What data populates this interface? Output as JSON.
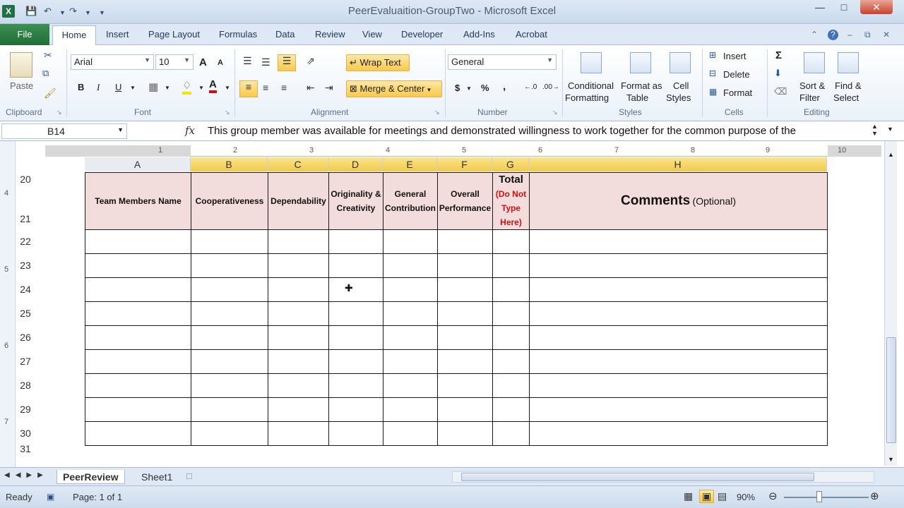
{
  "window": {
    "title": "PeerEvaluaition-GroupTwo - Microsoft Excel",
    "app_icon": "X"
  },
  "ribbon": {
    "tabs": [
      "File",
      "Home",
      "Insert",
      "Page Layout",
      "Formulas",
      "Data",
      "Review",
      "View",
      "Developer",
      "Add-Ins",
      "Acrobat"
    ],
    "clipboard": {
      "paste": "Paste",
      "label": "Clipboard"
    },
    "font": {
      "name": "Arial",
      "size": "10",
      "bold": "B",
      "italic": "I",
      "underline": "U",
      "label": "Font",
      "grow": "A",
      "shrink": "A"
    },
    "alignment": {
      "wrap_text": "Wrap Text",
      "merge_center": "Merge & Center",
      "label": "Alignment"
    },
    "number": {
      "format": "General",
      "currency": "$",
      "percent": "%",
      "comma": ",",
      "label": "Number"
    },
    "styles": {
      "conditional_1": "Conditional",
      "conditional_2": "Formatting",
      "format_table_1": "Format as",
      "format_table_2": "Table",
      "cell_styles_1": "Cell",
      "cell_styles_2": "Styles",
      "label": "Styles"
    },
    "cells": {
      "insert": "Insert",
      "delete": "Delete",
      "format": "Format",
      "label": "Cells"
    },
    "editing": {
      "sigma": "Σ",
      "sort_1": "Sort &",
      "sort_2": "Filter",
      "find_1": "Find &",
      "find_2": "Select",
      "label": "Editing"
    }
  },
  "formula_bar": {
    "name_box": "B14",
    "fx": "fx",
    "content": "This group member was available for meetings and demonstrated willingness to work together for the common purpose of the"
  },
  "ruler": {
    "marks": [
      "1",
      "2",
      "3",
      "4",
      "5",
      "6",
      "7",
      "8",
      "9",
      "10"
    ],
    "side_marks": [
      "4",
      "5",
      "6",
      "7"
    ]
  },
  "columns": [
    "A",
    "B",
    "C",
    "D",
    "E",
    "F",
    "G",
    "H"
  ],
  "rows": [
    "20",
    "21",
    "22",
    "23",
    "24",
    "25",
    "26",
    "27",
    "28",
    "29",
    "30",
    "31"
  ],
  "table_header": {
    "a": "Team Members Name",
    "b": "Cooperativeness",
    "c": "Dependability",
    "d1": "Originality &",
    "d2": "Creativity",
    "e1": "General",
    "e2": "Contribution",
    "f1": "Overall",
    "f2": "Performance",
    "g_title": "Total",
    "g1": "(Do Not",
    "g2": "Type",
    "g3": "Here)",
    "h_main": "Comments",
    "h_sub": "(Optional)"
  },
  "sheet_tabs": [
    "PeerReview",
    "Sheet1"
  ],
  "status": {
    "ready": "Ready",
    "page": "Page: 1 of 1",
    "zoom": "90%"
  },
  "colors": {
    "header_fill": "#f3dcdc",
    "selected_col": "#f2c94c",
    "file_tab": "#1f6e36",
    "red_text": "#d01010"
  }
}
